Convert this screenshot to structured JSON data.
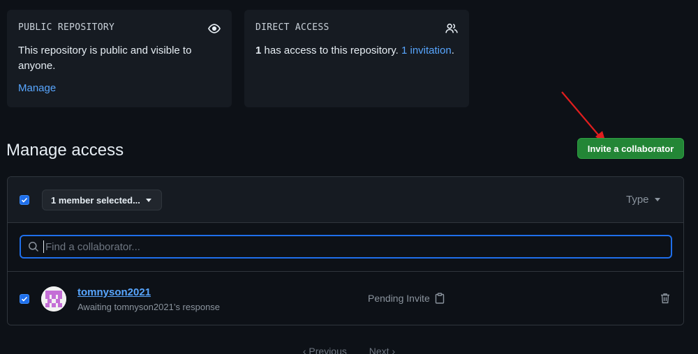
{
  "public_card": {
    "title": "PUBLIC REPOSITORY",
    "text": "This repository is public and visible to anyone.",
    "link": "Manage",
    "icon": "eye-icon"
  },
  "direct_card": {
    "title": "DIRECT ACCESS",
    "count": "1",
    "text": " has access to this repository. ",
    "invitation_link": "1 invitation",
    "period": ".",
    "icon": "people-icon"
  },
  "manage": {
    "title": "Manage access",
    "invite_button": "Invite a collaborator"
  },
  "toolbar": {
    "selected_label": "1 member selected...",
    "type_label": "Type"
  },
  "search": {
    "placeholder": "Find a collaborator..."
  },
  "members": [
    {
      "username": "tomnyson2021",
      "subtitle": "Awaiting tomnyson2021’s response",
      "status": "Pending Invite"
    }
  ],
  "pagination": {
    "previous": "‹ Previous",
    "next": "Next ›"
  },
  "colors": {
    "background": "#0d1117",
    "card": "#161b22",
    "accent_link": "#58a6ff",
    "primary_button": "#238636",
    "checkbox": "#1f6feb",
    "annotation_arrow": "#e01e1e"
  }
}
